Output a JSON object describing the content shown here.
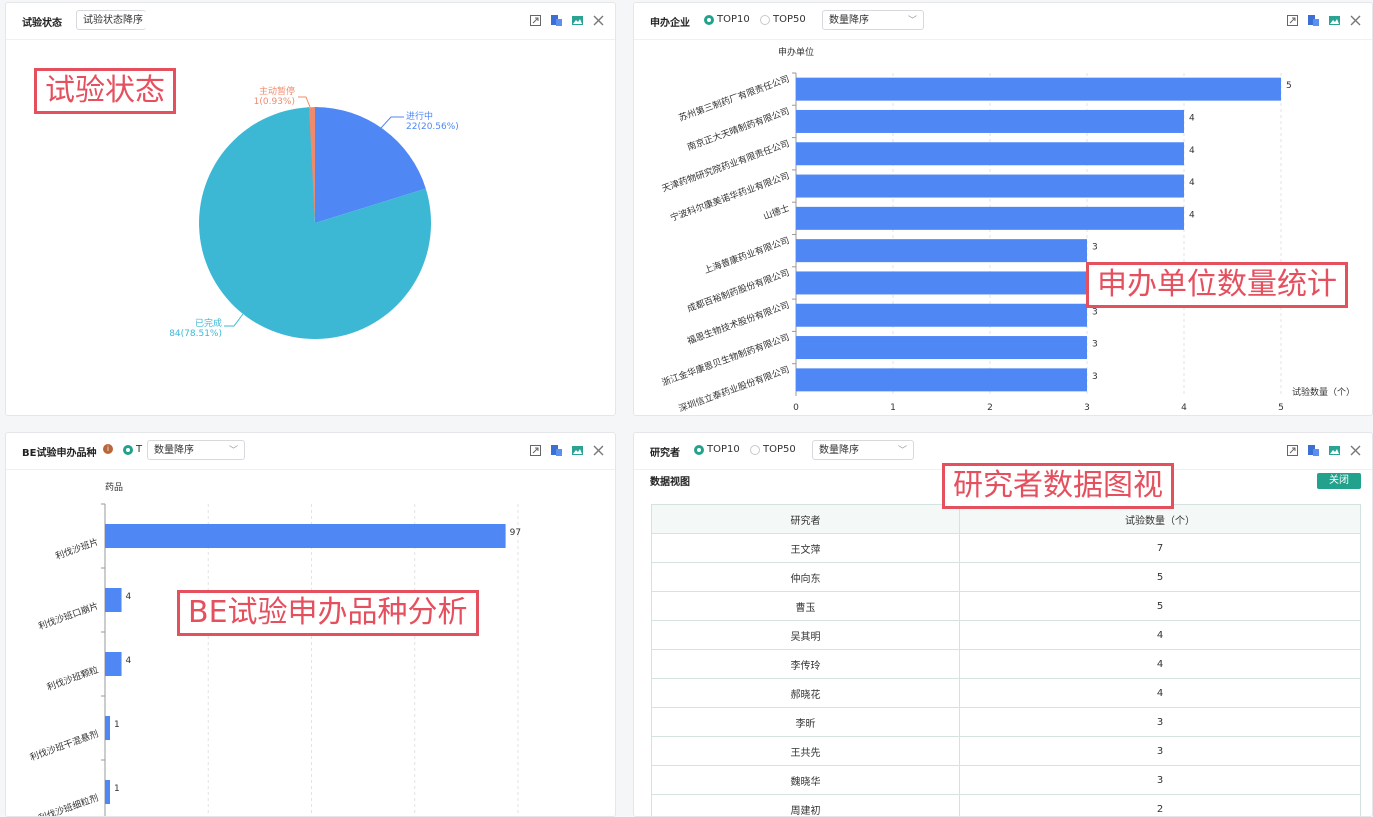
{
  "status_panel": {
    "title": "试验状态",
    "select_value": "试验状态降序",
    "callout": "试验状态",
    "chart_data": {
      "type": "pie",
      "slices": [
        {
          "name": "主动暂停",
          "value": 1,
          "label": "1(0.93%)",
          "color": "#f08a6c"
        },
        {
          "name": "进行中",
          "value": 22,
          "label": "22(20.56%)",
          "color": "#4f87f5"
        },
        {
          "name": "已完成",
          "value": 84,
          "label": "84(78.51%)",
          "color": "#3db8d4"
        }
      ]
    }
  },
  "sponsor_panel": {
    "title": "申办企业",
    "radio1": "TOP10",
    "radio2": "TOP50",
    "select_value": "数量降序",
    "callout": "申办单位数量统计",
    "chart_data": {
      "type": "bar",
      "orientation": "horizontal",
      "y_axis_name": "申办单位",
      "x_axis_name": "试验数量（个）",
      "categories": [
        "苏州第三制药厂有限责任公司",
        "南京正大天晴制药有限公司",
        "天津药物研究院药业有限责任公司",
        "宁波科尔康美诺华药业有限公司",
        "山德士",
        "上海普康药业有限公司",
        "成都百裕制药股份有限公司",
        "福恩生物技术股份有限公司",
        "浙江金华康恩贝生物制药有限公司",
        "深圳信立泰药业股份有限公司"
      ],
      "values": [
        5,
        4,
        4,
        4,
        4,
        3,
        3,
        3,
        3,
        3
      ],
      "x_ticks": [
        0,
        1,
        2,
        3,
        4,
        5
      ],
      "xlim": [
        0,
        5
      ],
      "color": "#4f87f5"
    }
  },
  "be_panel": {
    "title": "BE试验申办品种",
    "radio1": "T",
    "select_value": "数量降序",
    "callout": "BE试验申办品种分析",
    "chart_data": {
      "type": "bar",
      "orientation": "horizontal",
      "y_axis_name": "药品",
      "categories": [
        "利伐沙班片",
        "利伐沙班口崩片",
        "利伐沙班颗粒",
        "利伐沙班干混悬剂",
        "利伐沙班细粒剂"
      ],
      "values": [
        97,
        4,
        4,
        1,
        1
      ],
      "xlim": [
        0,
        100
      ],
      "color": "#4f87f5"
    }
  },
  "researcher_panel": {
    "title": "研究者",
    "radio1": "TOP10",
    "radio2": "TOP50",
    "select_value": "数量降序",
    "data_view_label": "数据视图",
    "close_button": "关闭",
    "callout": "研究者数据图视",
    "table": {
      "headers": [
        "研究者",
        "试验数量（个）"
      ],
      "rows": [
        [
          "王文萍",
          "7"
        ],
        [
          "仲向东",
          "5"
        ],
        [
          "曹玉",
          "5"
        ],
        [
          "吴其明",
          "4"
        ],
        [
          "李传玲",
          "4"
        ],
        [
          "郝晓花",
          "4"
        ],
        [
          "李昕",
          "3"
        ],
        [
          "王共先",
          "3"
        ],
        [
          "魏晓华",
          "3"
        ],
        [
          "周建初",
          "2"
        ]
      ]
    }
  },
  "icons": [
    "fullscreen-icon",
    "data-view-icon",
    "save-image-icon",
    "close-icon"
  ]
}
